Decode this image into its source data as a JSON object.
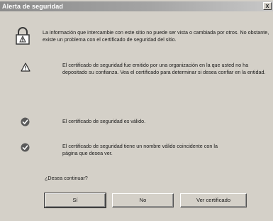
{
  "dialog": {
    "title": "Alerta de seguridad",
    "close_glyph": "x",
    "intro_text": "La información que intercambie con este sitio no puede ser vista o cambiada por otros. No obstante, existe un problema con el certificado de seguridad del sitio.",
    "items": [
      {
        "icon": "warning-icon",
        "text": "El certificado de seguridad fue emitido por una organización en la que usted no ha depositado su confianza. Vea el certificado para determinar si desea confiar en la entidad."
      },
      {
        "icon": "check-icon",
        "text": "El certificado de seguridad es válido."
      },
      {
        "icon": "check-icon",
        "text": "El certificado de seguridad tiene un nombre válido coincidente con la página que desea ver."
      }
    ],
    "question": "¿Desea continuar?",
    "buttons": {
      "yes": "Sí",
      "no": "No",
      "view_cert": "Ver certificado"
    }
  },
  "colors": {
    "dialog_bg": "#d4d0c8",
    "titlebar_start": "#8c8c8c",
    "titlebar_end": "#c8c8c8",
    "text": "#1a1a1a"
  }
}
